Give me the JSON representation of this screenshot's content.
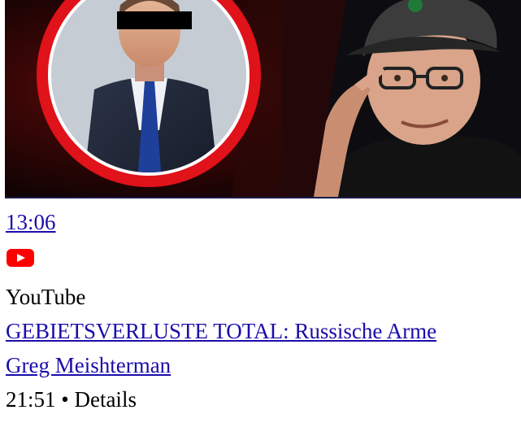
{
  "video": {
    "duration": "13:06",
    "source_icon": "youtube-icon",
    "source": "YouTube",
    "title": "GEBIETSVERLUSTE TOTAL: Russische Arme",
    "channel": "Greg Meishterman",
    "time": "21:51",
    "separator": "•",
    "details": "Details"
  },
  "colors": {
    "link": "#1a0dab",
    "youtube_red": "#ff0000",
    "ring_red": "#e0121a"
  }
}
